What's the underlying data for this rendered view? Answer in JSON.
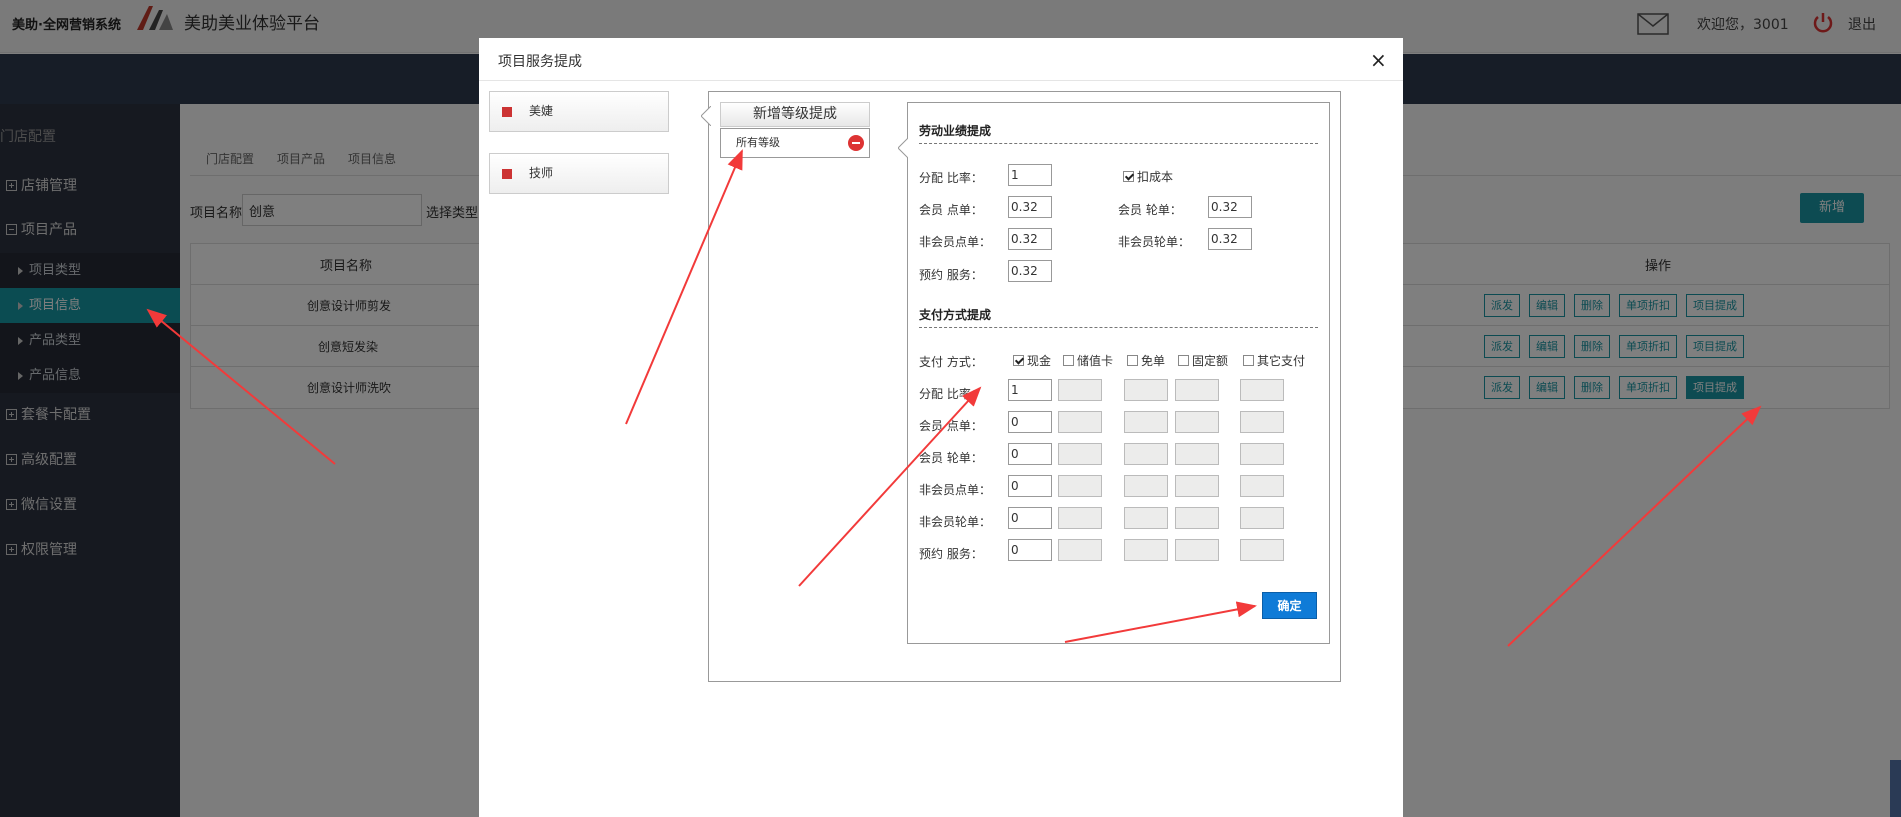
{
  "header": {
    "brand": "美助·全网营销系统",
    "platform": "美助美业体验平台",
    "welcome": "欢迎您，3001",
    "logout": "退出"
  },
  "sidebar": {
    "title": "门店配置",
    "items": [
      {
        "label": "店铺管理"
      },
      {
        "label": "项目产品"
      },
      {
        "label": "套餐卡配置"
      },
      {
        "label": "高级配置"
      },
      {
        "label": "微信设置"
      },
      {
        "label": "权限管理"
      }
    ],
    "subitems": [
      {
        "label": "项目类型"
      },
      {
        "label": "项目信息"
      },
      {
        "label": "产品类型"
      },
      {
        "label": "产品信息"
      }
    ]
  },
  "breadcrumb": [
    "门店配置",
    "项目产品",
    "项目信息"
  ],
  "filter": {
    "name_label": "项目名称",
    "name_value": "创意",
    "type_label": "选择类型",
    "add_button": "新增"
  },
  "table": {
    "headers": {
      "name": "项目名称",
      "ops": "操作"
    },
    "rows": [
      {
        "name": "创意设计师剪发"
      },
      {
        "name": "创意短发染"
      },
      {
        "name": "创意设计师洗吹"
      }
    ],
    "op_labels": [
      "派发",
      "编辑",
      "删除",
      "单项折扣",
      "项目提成"
    ]
  },
  "modal": {
    "title": "项目服务提成",
    "roles": [
      "美婕",
      "技师"
    ],
    "new_level_button": "新增等级提成",
    "level_item": "所有等级",
    "labor": {
      "title": "劳动业绩提成",
      "ratio_label": "分配   比率：",
      "ratio_value": "1",
      "deduct_cost_label": "扣成本",
      "member_point_label": "会员   点单：",
      "member_point_value": "0.32",
      "member_turn_label": "会员   轮单：",
      "member_turn_value": "0.32",
      "nonmember_point_label": "非会员点单：",
      "nonmember_point_value": "0.32",
      "nonmember_turn_label": "非会员轮单：",
      "nonmember_turn_value": "0.32",
      "reserve_label": "预约   服务：",
      "reserve_value": "0.32"
    },
    "payment": {
      "title": "支付方式提成",
      "method_label": "支付   方式：",
      "methods": [
        {
          "label": "现金",
          "checked": true
        },
        {
          "label": "储值卡",
          "checked": false
        },
        {
          "label": "免单",
          "checked": false
        },
        {
          "label": "固定额",
          "checked": false
        },
        {
          "label": "其它支付",
          "checked": false
        }
      ],
      "rows": [
        {
          "label": "分配   比率：",
          "value": "1"
        },
        {
          "label": "会员   点单：",
          "value": "0"
        },
        {
          "label": "会员   轮单：",
          "value": "0"
        },
        {
          "label": "非会员点单：",
          "value": "0"
        },
        {
          "label": "非会员轮单：",
          "value": "0"
        },
        {
          "label": "预约   服务：",
          "value": "0"
        }
      ]
    },
    "confirm_button": "确定"
  },
  "colors": {
    "accent": "#1a97a5",
    "sidebar": "#2d3241",
    "confirm": "#0f7bd7",
    "annotation_arrow": "#f23a3a"
  },
  "icons": [
    "mail-icon",
    "power-icon",
    "close-icon",
    "remove-icon"
  ]
}
